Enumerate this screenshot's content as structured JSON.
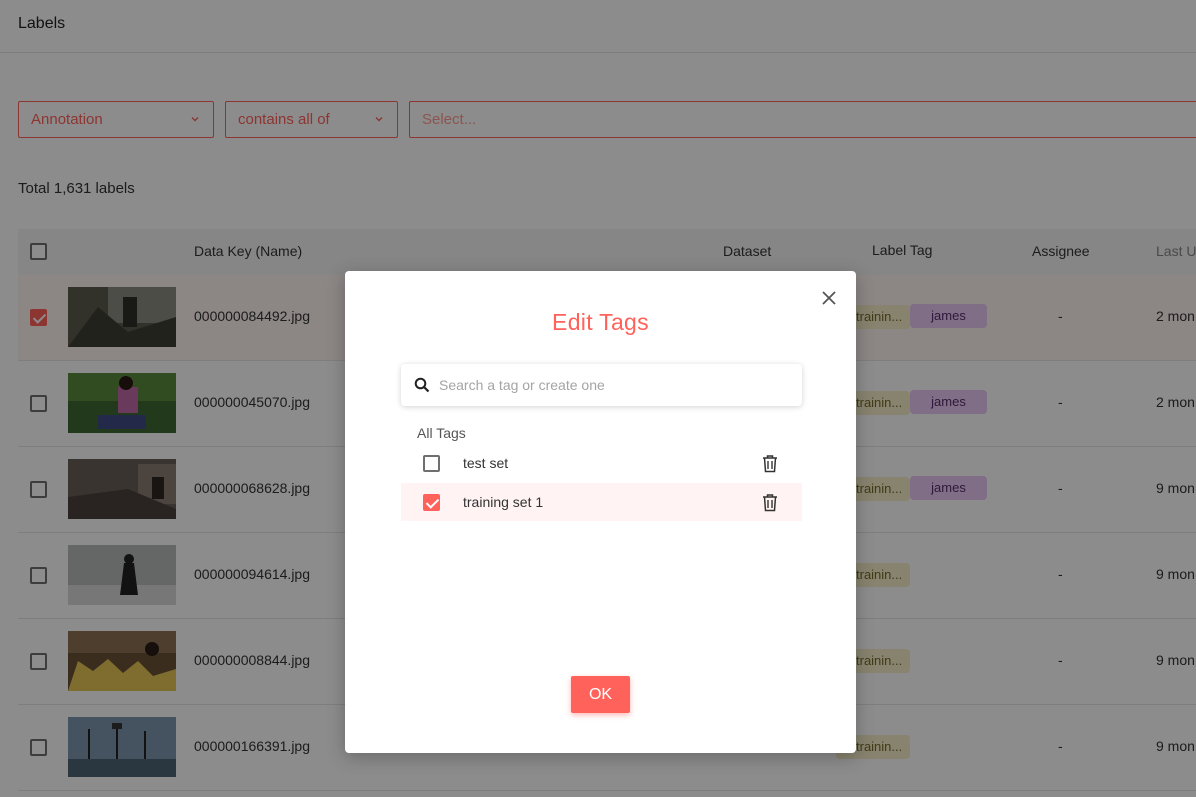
{
  "header": {
    "title": "Labels"
  },
  "filters": {
    "field": "Annotation",
    "operator": "contains all of",
    "value_placeholder": "Select..."
  },
  "summary": {
    "total_text": "Total 1,631 labels"
  },
  "table": {
    "columns": {
      "name": "Data Key (Name)",
      "dataset": "Dataset",
      "label_tag": "Label Tag",
      "assignee": "Assignee",
      "last": "Last U"
    },
    "rows": [
      {
        "name": "000000084492.jpg",
        "dataset": "trainin...",
        "tag": "james",
        "assignee": "-",
        "last": "2 mon",
        "checked": true
      },
      {
        "name": "000000045070.jpg",
        "dataset": "trainin...",
        "tag": "james",
        "assignee": "-",
        "last": "2 mon",
        "checked": false
      },
      {
        "name": "000000068628.jpg",
        "dataset": "trainin...",
        "tag": "james",
        "assignee": "-",
        "last": "9 mon",
        "checked": false
      },
      {
        "name": "000000094614.jpg",
        "dataset": "trainin...",
        "tag": "",
        "assignee": "-",
        "last": "9 mon",
        "checked": false
      },
      {
        "name": "000000008844.jpg",
        "dataset": "trainin...",
        "tag": "",
        "assignee": "-",
        "last": "9 mon",
        "checked": false
      },
      {
        "name": "000000166391.jpg",
        "dataset": "trainin...",
        "tag": "",
        "assignee": "-",
        "last": "9 mon",
        "checked": false
      }
    ]
  },
  "modal": {
    "title": "Edit Tags",
    "search_placeholder": "Search a tag or create one",
    "section_label": "All Tags",
    "tags": [
      {
        "name": "test set",
        "checked": false
      },
      {
        "name": "training set 1",
        "checked": true
      }
    ],
    "ok_label": "OK"
  },
  "colors": {
    "accent": "#ff625a",
    "dataset_chip": "#f6eecb",
    "tag_chip": "#e7c9f2",
    "overlay": "rgba(0,0,0,0.45)"
  },
  "icons": [
    "chevron-down-icon",
    "search-icon",
    "close-icon",
    "trash-icon",
    "checkbox-icon"
  ]
}
